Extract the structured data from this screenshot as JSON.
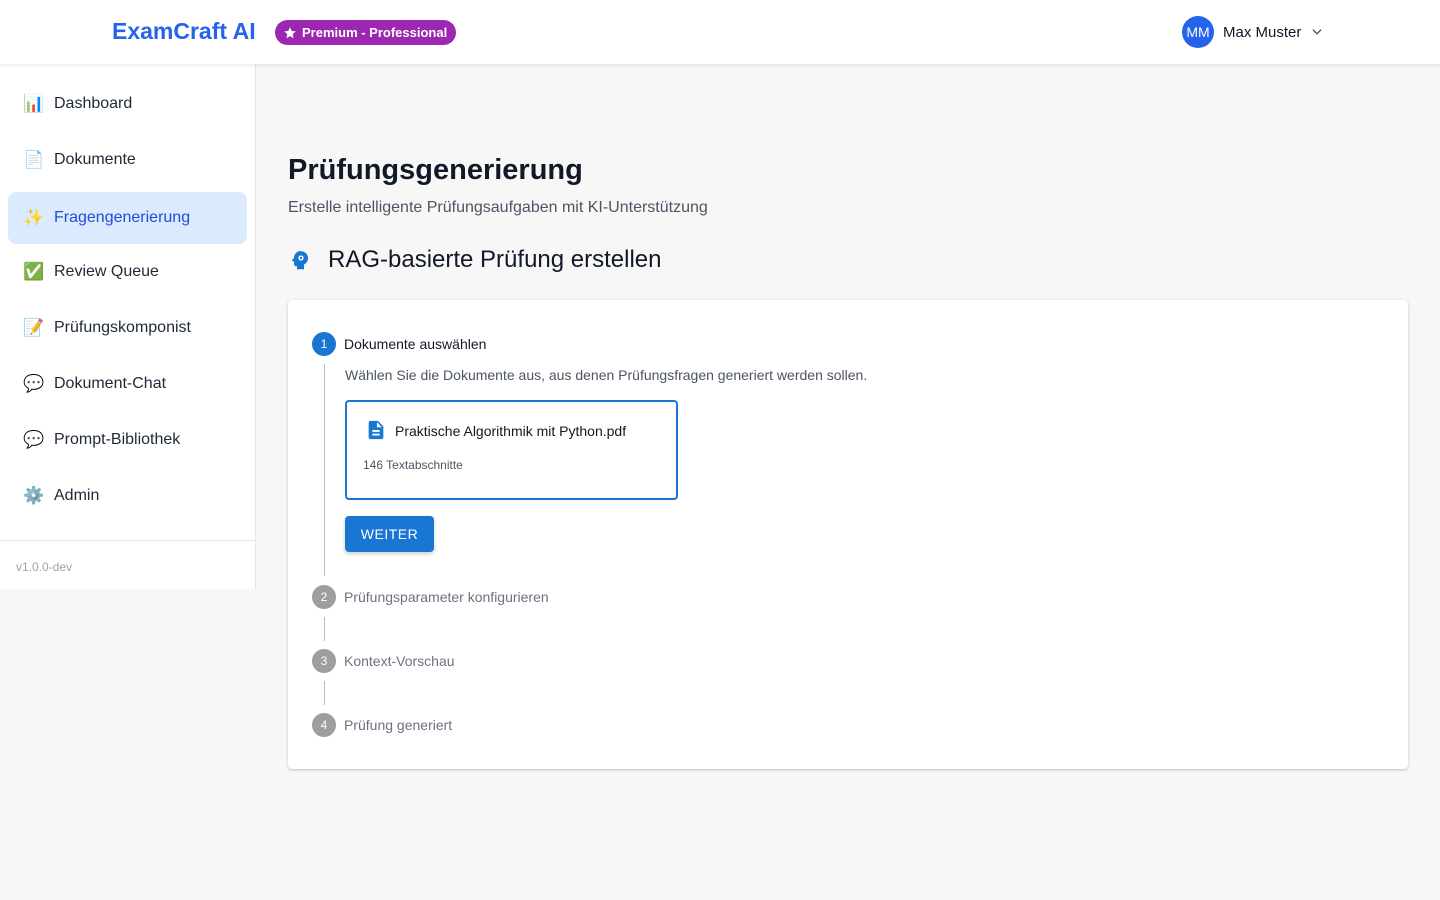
{
  "header": {
    "brand": "ExamCraft AI",
    "plan_badge": "Premium - Professional",
    "plan_icon": "star-icon",
    "user_initials": "MM",
    "user_name": "Max Muster"
  },
  "sidebar": {
    "items": [
      {
        "label": "Dashboard",
        "icon": "bar-chart-icon",
        "glyph": "📊",
        "active": false
      },
      {
        "label": "Dokumente",
        "icon": "document-icon",
        "glyph": "📄",
        "active": false
      },
      {
        "label": "Fragengenerierung",
        "icon": "sparkles-icon",
        "glyph": "✨",
        "active": true
      },
      {
        "label": "Review Queue",
        "icon": "check-mark-icon",
        "glyph": "✅",
        "active": false
      },
      {
        "label": "Prüfungskomponist",
        "icon": "memo-icon",
        "glyph": "📝",
        "active": false
      },
      {
        "label": "Dokument-Chat",
        "icon": "speech-bubble-icon",
        "glyph": "💬",
        "active": false
      },
      {
        "label": "Prompt-Bibliothek",
        "icon": "speech-bubble-icon",
        "glyph": "💬",
        "active": false
      },
      {
        "label": "Admin",
        "icon": "gear-icon",
        "glyph": "⚙️",
        "active": false
      }
    ],
    "version": "v1.0.0-dev"
  },
  "main": {
    "title": "Prüfungsgenerierung",
    "subtitle": "Erstelle intelligente Prüfungsaufgaben mit KI-Unterstützung",
    "section_title": "RAG-basierte Prüfung erstellen",
    "section_icon": "psychology-icon",
    "stepper": {
      "steps": [
        {
          "number": "1",
          "label": "Dokumente auswählen",
          "active": true
        },
        {
          "number": "2",
          "label": "Prüfungsparameter konfigurieren",
          "active": false
        },
        {
          "number": "3",
          "label": "Kontext-Vorschau",
          "active": false
        },
        {
          "number": "4",
          "label": "Prüfung generiert",
          "active": false
        }
      ],
      "step1": {
        "description": "Wählen Sie die Dokumente aus, aus denen Prüfungsfragen generiert werden sollen.",
        "document": {
          "name": "Praktische Algorithmik mit Python.pdf",
          "meta": "146 Textabschnitte",
          "selected": true
        },
        "next_label": "WEITER"
      }
    }
  },
  "colors": {
    "brand": "#2563eb",
    "badge": "#9c27b0",
    "primary": "#1976d2",
    "active_nav_bg": "#dbeafe",
    "inactive_step": "#9e9e9e"
  }
}
